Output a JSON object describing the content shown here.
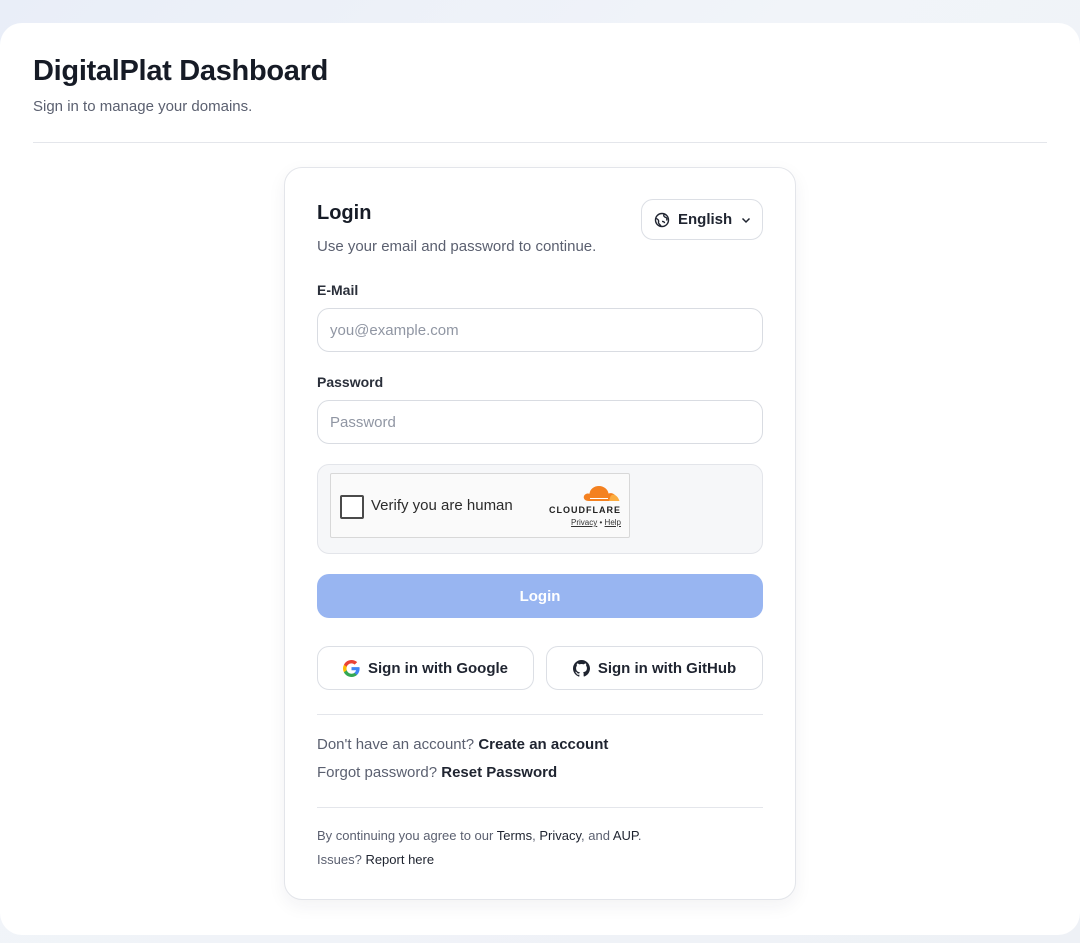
{
  "header": {
    "title": "DigitalPlat Dashboard",
    "subtitle": "Sign in to manage your domains."
  },
  "card": {
    "title": "Login",
    "subtitle": "Use your email and password to continue.",
    "language": {
      "label": "English",
      "icon": "globe-icon"
    }
  },
  "form": {
    "email_label": "E-Mail",
    "email_placeholder": "you@example.com",
    "email_value": "",
    "password_label": "Password",
    "password_placeholder": "Password",
    "password_value": "",
    "login_label": "Login"
  },
  "captcha": {
    "text": "Verify you are human",
    "brand": "CLOUDFLARE",
    "privacy": "Privacy",
    "separator": "•",
    "help": "Help"
  },
  "oauth": {
    "google_label": "Sign in with Google",
    "github_label": "Sign in with GitHub"
  },
  "links": {
    "no_account": "Don't have an account?",
    "create_account": "Create an account",
    "forgot": "Forgot password?",
    "reset": "Reset Password"
  },
  "legal": {
    "prefix": "By continuing you agree to our",
    "terms": "Terms",
    "comma": ",",
    "privacy": "Privacy",
    "and": ", and",
    "aup": "AUP",
    "period": ".",
    "issues": "Issues?",
    "report": "Report here"
  },
  "colors": {
    "login_button": "#98b5f1",
    "cloudflare_orange": "#f48120"
  }
}
